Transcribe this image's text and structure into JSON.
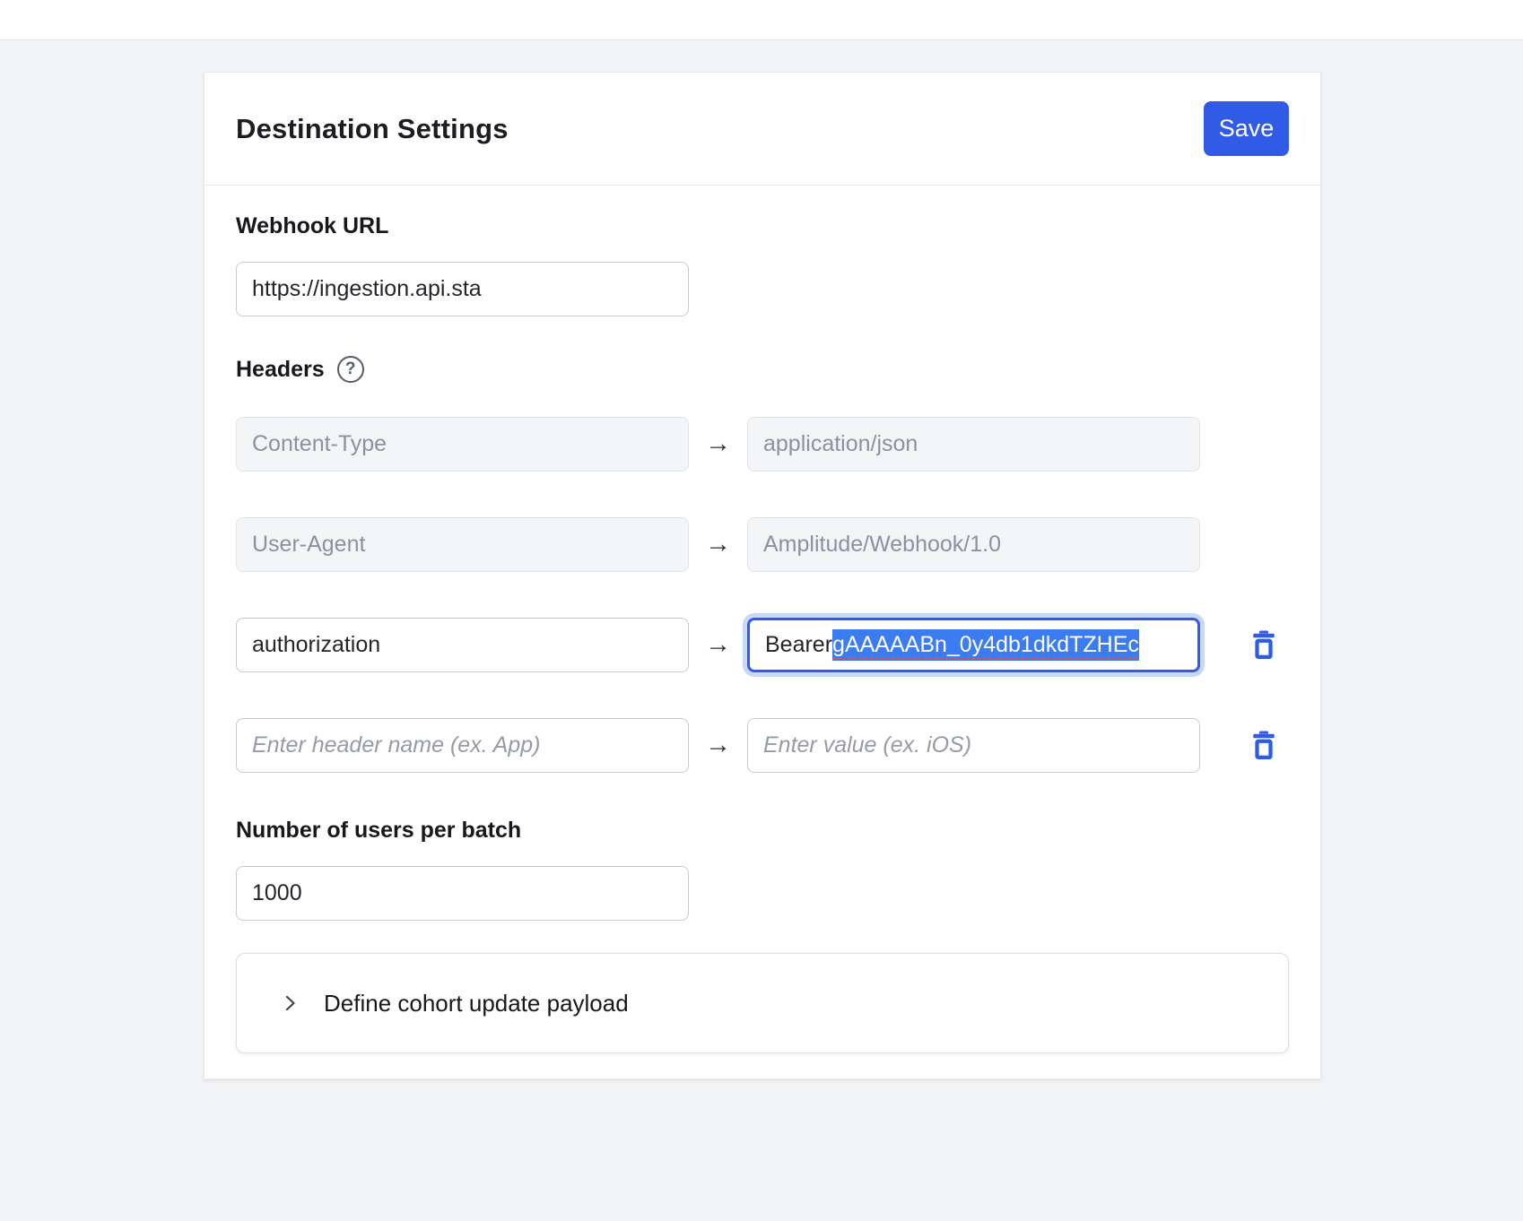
{
  "card": {
    "title": "Destination Settings",
    "save_label": "Save"
  },
  "webhook_url": {
    "label": "Webhook URL",
    "value": "https://ingestion.api.sta"
  },
  "headers": {
    "label": "Headers",
    "rows": [
      {
        "state": "disabled",
        "key": "Content-Type",
        "value": "application/json"
      },
      {
        "state": "disabled",
        "key": "User-Agent",
        "value": "Amplitude/Webhook/1.0"
      },
      {
        "state": "editing",
        "key": "authorization",
        "value_prefix": "Bearer ",
        "value_selected": "gAAAAABn_0y4db1dkdTZHEc"
      },
      {
        "state": "empty",
        "key_placeholder": "Enter header name (ex. App)",
        "value_placeholder": "Enter value (ex. iOS)"
      }
    ]
  },
  "batch": {
    "label": "Number of users per batch",
    "value": "1000"
  },
  "payload_panel": {
    "label": "Define cohort update payload"
  },
  "icons": {
    "arrow": "→",
    "help": "?"
  },
  "colors": {
    "accent_blue": "#2f5be7",
    "selection_blue": "#3b7cf3",
    "focus_ring": "#c9d7f8",
    "page_background": "#f2f3f5",
    "disabled_background": "#f4f5f7",
    "disabled_text": "#8b91a0",
    "spellcheck_red": "#dd5050"
  }
}
